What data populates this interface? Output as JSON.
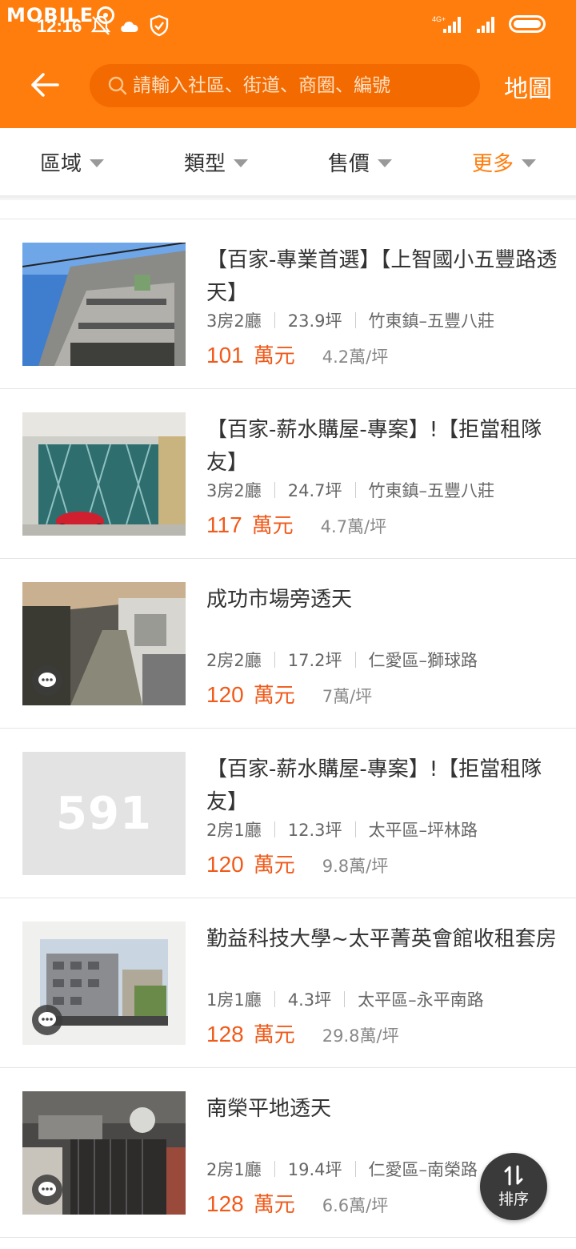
{
  "status_bar": {
    "watermark": "MOBILE",
    "time": "12:16",
    "network": "4G+"
  },
  "header": {
    "search_placeholder": "請輸入社區、街道、商圈、編號",
    "map_label": "地圖"
  },
  "filters": [
    {
      "label": "區域"
    },
    {
      "label": "類型"
    },
    {
      "label": "售價"
    },
    {
      "label": "更多"
    }
  ],
  "listings": [
    {
      "title": "【百家-專業首選】【上智國小五豐路透天】",
      "rooms": "3房2廳",
      "area": "23.9坪",
      "location": "竹東鎮–五豐八莊",
      "price": "101",
      "unit": "萬元",
      "per_ping": "4.2萬/坪"
    },
    {
      "title": "【百家-薪水購屋-專案】!【拒當租隊友】",
      "rooms": "3房2廳",
      "area": "24.7坪",
      "location": "竹東鎮–五豐八莊",
      "price": "117",
      "unit": "萬元",
      "per_ping": "4.7萬/坪"
    },
    {
      "title": "成功市場旁透天",
      "rooms": "2房2廳",
      "area": "17.2坪",
      "location": "仁愛區–獅球路",
      "price": "120",
      "unit": "萬元",
      "per_ping": "7萬/坪"
    },
    {
      "title": "【百家-薪水購屋-專案】!【拒當租隊友】",
      "rooms": "2房1廳",
      "area": "12.3坪",
      "location": "太平區–坪林路",
      "price": "120",
      "unit": "萬元",
      "per_ping": "9.8萬/坪",
      "placeholder_logo": "591"
    },
    {
      "title": "勤益科技大學~太平菁英會館收租套房",
      "rooms": "1房1廳",
      "area": "4.3坪",
      "location": "太平區–永平南路",
      "price": "128",
      "unit": "萬元",
      "per_ping": "29.8萬/坪"
    },
    {
      "title": "南榮平地透天",
      "rooms": "2房1廳",
      "area": "19.4坪",
      "location": "仁愛區–南榮路",
      "price": "128",
      "unit": "萬元",
      "per_ping": "6.6萬/坪"
    }
  ],
  "sort_button": {
    "label": "排序"
  },
  "colors": {
    "brand": "#ff7d0c",
    "price": "#f05a1a"
  }
}
